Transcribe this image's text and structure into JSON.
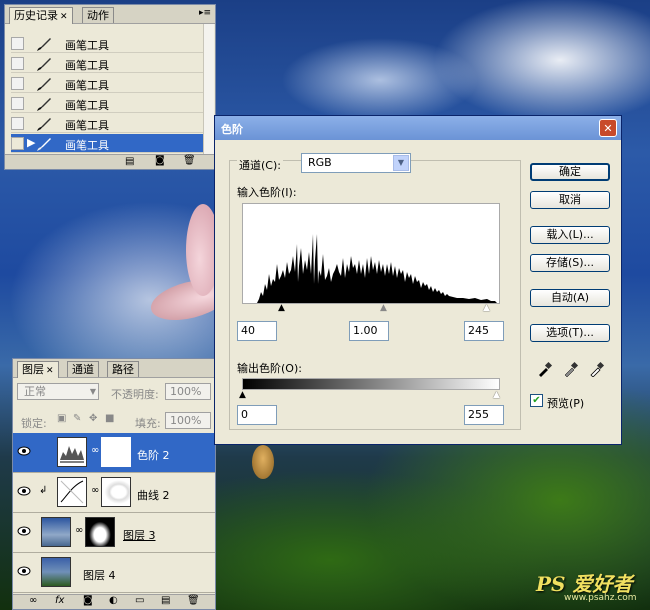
{
  "history_panel": {
    "tabs": [
      "历史记录",
      "动作"
    ],
    "items": [
      {
        "label": "画笔工具"
      },
      {
        "label": "画笔工具"
      },
      {
        "label": "画笔工具"
      },
      {
        "label": "画笔工具"
      },
      {
        "label": "画笔工具"
      },
      {
        "label": "画笔工具"
      }
    ]
  },
  "layers_panel": {
    "tabs": [
      "图层",
      "通道",
      "路径"
    ],
    "blend_mode": "正常",
    "opacity_label": "不透明度:",
    "opacity_value": "100%",
    "lock_label": "锁定:",
    "fill_label": "填充:",
    "fill_value": "100%",
    "layers": [
      {
        "name": "色阶 2",
        "selected": true
      },
      {
        "name": "曲线 2",
        "selected": false
      },
      {
        "name": "图层 3",
        "selected": false
      },
      {
        "name": "图层 4",
        "selected": false
      }
    ]
  },
  "levels_dialog": {
    "title": "色阶",
    "channel_label": "通道(C):",
    "channel_value": "RGB",
    "input_levels_label": "输入色阶(I):",
    "input_black": "40",
    "input_gamma": "1.00",
    "input_white": "245",
    "output_levels_label": "输出色阶(O):",
    "output_black": "0",
    "output_white": "255",
    "buttons": {
      "ok": "确定",
      "cancel": "取消",
      "load": "载入(L)...",
      "save": "存储(S)...",
      "auto": "自动(A)",
      "options": "选项(T)..."
    },
    "preview_label": "预览(P)",
    "preview_checked": true
  },
  "watermark": {
    "logo": "PS 爱好者",
    "url": "www.psahz.com"
  }
}
